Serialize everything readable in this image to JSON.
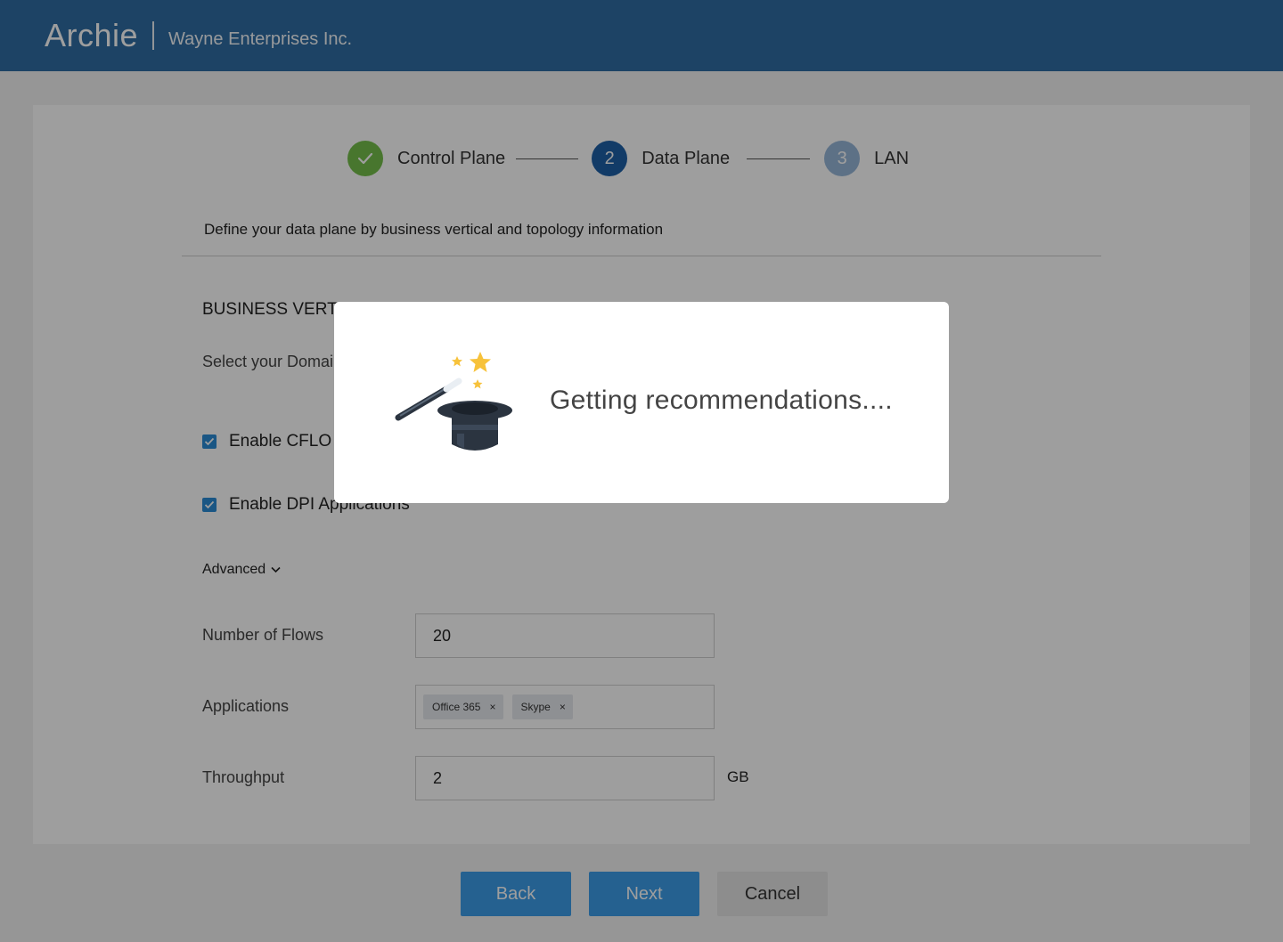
{
  "header": {
    "brand": "Archie",
    "company": "Wayne Enterprises Inc.",
    "background": "#2f6da3"
  },
  "stepper": {
    "steps": [
      {
        "number": "",
        "label": "Control Plane",
        "state": "done",
        "icon": "check-icon"
      },
      {
        "number": "2",
        "label": "Data Plane",
        "state": "active"
      },
      {
        "number": "3",
        "label": "LAN",
        "state": "pending"
      }
    ]
  },
  "main": {
    "subtitle": "Define your data plane by business vertical and topology information",
    "section_title": "BUSINESS VERT",
    "domain_label": "Select your Domai",
    "checkboxes": [
      {
        "label": "Enable CFLO",
        "checked": true
      },
      {
        "label": "Enable DPI Applications",
        "checked": true
      }
    ],
    "advanced_label": "Advanced",
    "fields": {
      "flows": {
        "label": "Number of Flows",
        "value": "20"
      },
      "applications": {
        "label": "Applications",
        "chips": [
          "Office 365",
          "Skype"
        ],
        "remove_glyph": "×"
      },
      "throughput": {
        "label": "Throughput",
        "value": "2",
        "unit": "GB"
      }
    }
  },
  "footer": {
    "back_label": "Back",
    "next_label": "Next",
    "cancel_label": "Cancel"
  },
  "modal": {
    "message": "Getting recommendations....",
    "icon": "magic-hat-icon"
  },
  "colors": {
    "primary": "#3d9de8",
    "step_done": "#74bf4b",
    "step_active": "#1e5fa6",
    "step_pending": "#97b7d9"
  }
}
